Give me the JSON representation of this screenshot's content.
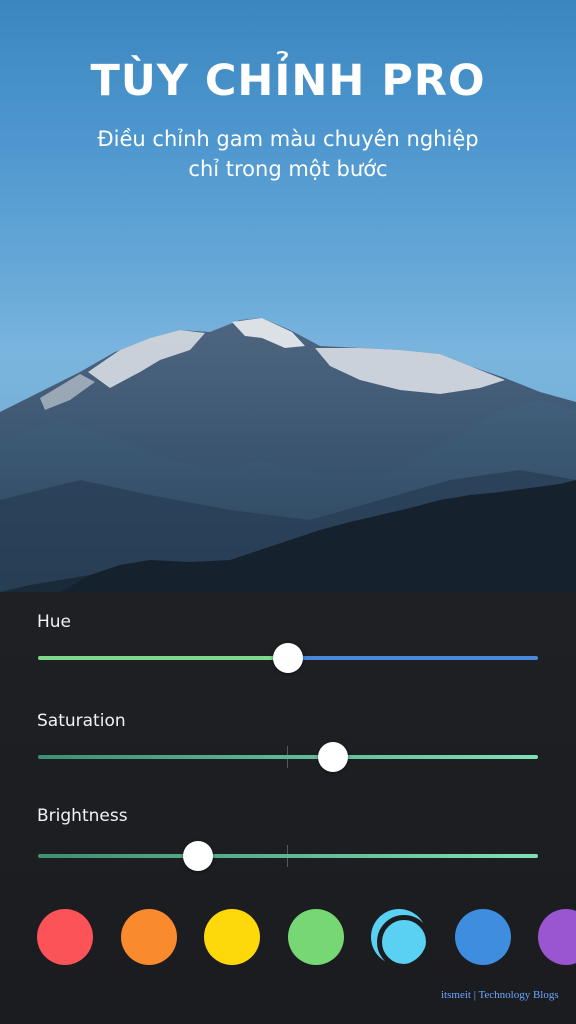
{
  "header": {
    "title": "TÙY CHỈNH PRO",
    "subtitle_line1": "Điều chỉnh gam màu chuyên nghiệp",
    "subtitle_line2": "chỉ trong một bước"
  },
  "sliders": [
    {
      "label": "Hue",
      "value": 0.5,
      "track_left_color": "#7fd98a",
      "track_right_color": "#4a86d9"
    },
    {
      "label": "Saturation",
      "value": 0.59,
      "track_color": "#7fe0b5"
    },
    {
      "label": "Brightness",
      "value": 0.32,
      "track_color": "#7fe0b5"
    }
  ],
  "swatches": [
    {
      "name": "red",
      "color": "#fb5358"
    },
    {
      "name": "orange",
      "color": "#fa8a2e"
    },
    {
      "name": "yellow",
      "color": "#fdd80b"
    },
    {
      "name": "green",
      "color": "#78d775"
    },
    {
      "name": "cyan",
      "color": "#5ad1f2",
      "selected": true
    },
    {
      "name": "blue",
      "color": "#3e8ddf"
    },
    {
      "name": "purple",
      "color": "#9a55d1"
    }
  ],
  "watermark": "itsmeit | Technology Blogs"
}
